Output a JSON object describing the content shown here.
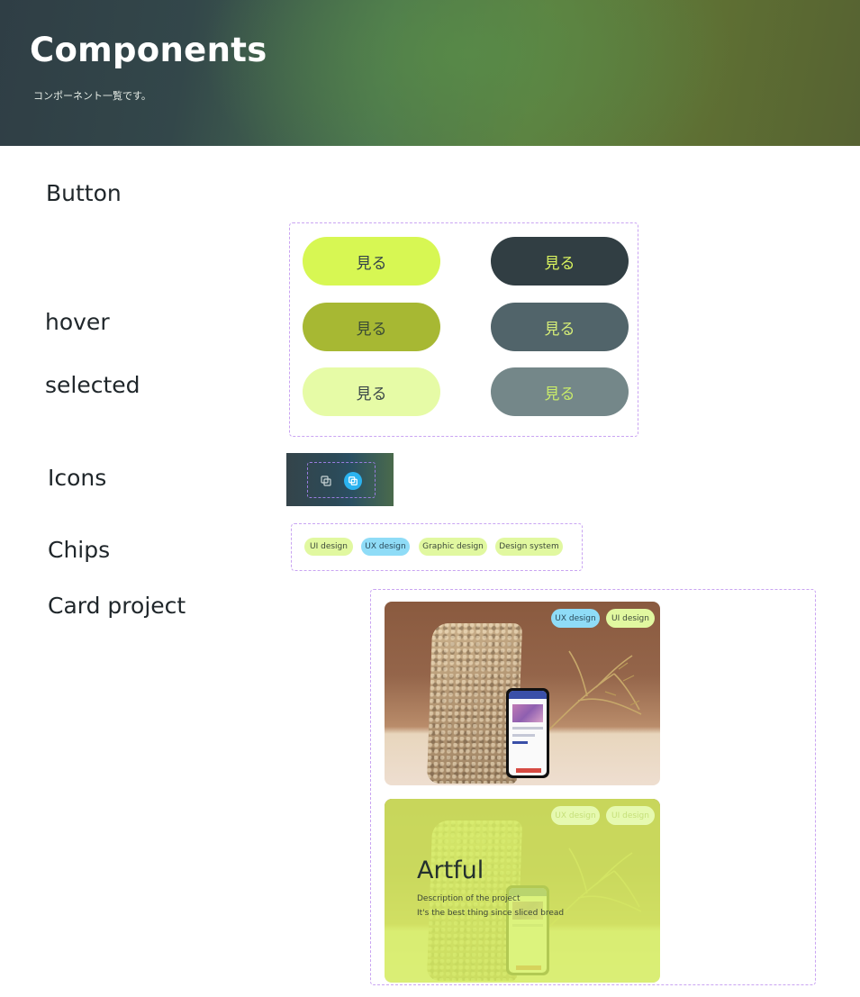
{
  "header": {
    "title": "Components",
    "subtitle": "コンポーネント一覧です。"
  },
  "sections": {
    "button": "Button",
    "hover": "hover",
    "selected": "selected",
    "icons": "Icons",
    "chips": "Chips",
    "card_project": "Card project"
  },
  "buttons": {
    "label": "見る"
  },
  "icons": {
    "items": [
      "copy-icon",
      "copy-icon-active"
    ],
    "active_color": "#2bb3f0"
  },
  "chips": {
    "items": [
      "UI design",
      "UX design",
      "Graphic design",
      "Design system"
    ]
  },
  "card": {
    "chips": [
      "UX design",
      "UI design"
    ],
    "title": "Artful",
    "description_line1": "Description of the project",
    "description_line2": "It's the best thing since sliced bread"
  },
  "colors": {
    "lime": "#d7f753",
    "dark": "#313e43",
    "chip_blue": "#8fdcf7",
    "dashed_border": "#c9a4f2"
  }
}
